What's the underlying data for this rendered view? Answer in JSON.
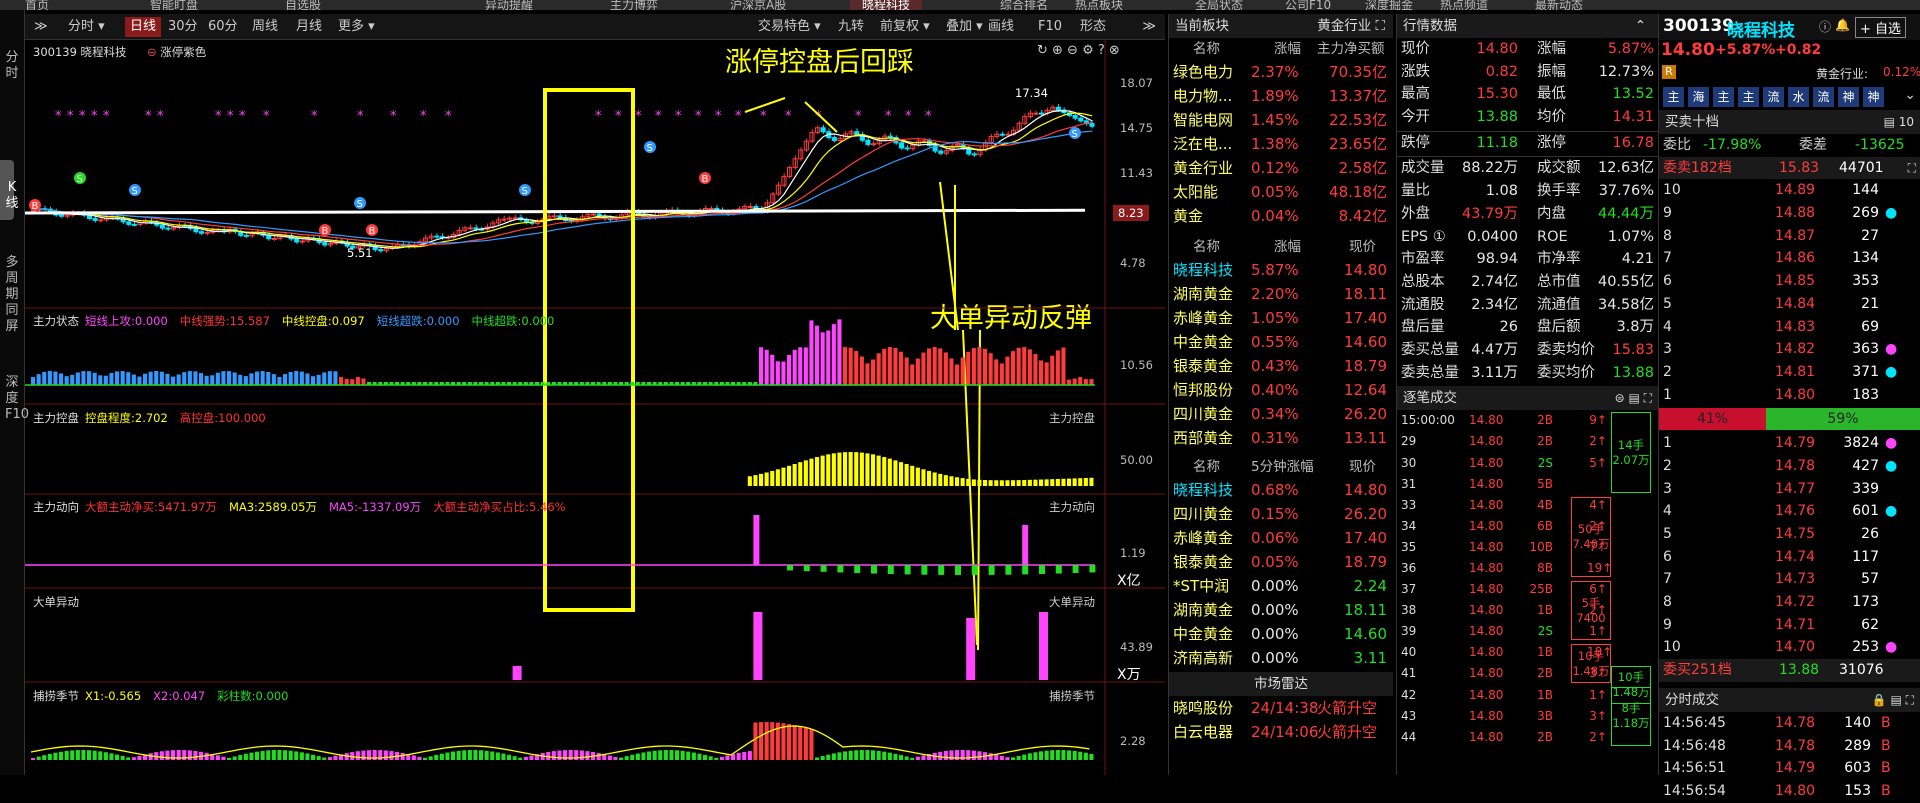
{
  "topbar": {
    "tabs": [
      "首页",
      "智能盯盘",
      "自选股",
      "异动提醒",
      "主力博弈",
      "沪深京A股",
      "晓程科技",
      "综合排名",
      "热点板块",
      "全局状态",
      "公司F10",
      "深度掘金",
      "热点频道",
      "最新动态"
    ],
    "active": 6
  },
  "leftbar": {
    "items": [
      "分时",
      "K线",
      "多周期同屏",
      "深度F10"
    ]
  },
  "toolbar": {
    "left": [
      "分时",
      "日线",
      "30分",
      "60分",
      "周线",
      "月线",
      "更多"
    ],
    "active": "日线",
    "right": [
      "交易特色",
      "九转",
      "前复权",
      "叠加",
      "画线",
      "F10",
      "形态"
    ]
  },
  "chart": {
    "stock_title": "300139 晓程科技",
    "indicator": "涨停紫色",
    "annotation1": "涨停控盘后回踩",
    "annotation2": "大单异动反弹",
    "axis_main": [
      "18.07",
      "14.75",
      "11.43",
      "8.23",
      "4.78"
    ],
    "low_label": "5.51",
    "high_label": "17.34",
    "p1": {
      "title": "主力状态",
      "items": [
        {
          "t": "短线上攻:0.000",
          "c": "#ff44ff"
        },
        {
          "t": "中线强势:15.587",
          "c": "#ff3333"
        },
        {
          "t": "中线控盘:0.097",
          "c": "#ffff00"
        },
        {
          "t": "短线超跌:0.000",
          "c": "#3399ff"
        },
        {
          "t": "中线超跌:0.000",
          "c": "#22dd22"
        }
      ],
      "axis": "10.56"
    },
    "p2": {
      "title": "主力控盘",
      "items": [
        {
          "t": "控盘程度:2.702",
          "c": "#ffff00"
        },
        {
          "t": "高控盘:100.000",
          "c": "#ff3333"
        }
      ],
      "right": "主力控盘",
      "axis": "50.00"
    },
    "p3": {
      "title": "主力动向",
      "items": [
        {
          "t": "大额主动净买:5471.97万",
          "c": "#ff3333"
        },
        {
          "t": "MA3:2589.05万",
          "c": "#ffff00"
        },
        {
          "t": "MA5:-1337.09万",
          "c": "#ff44ff"
        },
        {
          "t": "大额主动净买占比:5.46%",
          "c": "#ff3333"
        }
      ],
      "right": "主力动向",
      "axis": "1.19",
      "unit": "X亿"
    },
    "p4": {
      "title": "大单异动",
      "right": "大单异动",
      "axis": "43.89",
      "unit": "X万"
    },
    "p5": {
      "title": "捕捞季节",
      "items": [
        {
          "t": "X1:-0.565",
          "c": "#ffff00"
        },
        {
          "t": "X2:0.047",
          "c": "#ff44ff"
        },
        {
          "t": "彩柱数:0.000",
          "c": "#22dd22"
        }
      ],
      "right": "捕捞季节",
      "axis": "2.28"
    }
  },
  "sector": {
    "title": "当前板块",
    "right": "黄金行业",
    "cols": [
      "名称",
      "涨幅",
      "主力净买额"
    ],
    "rows": [
      [
        "绿色电力",
        "2.37%",
        "70.35亿"
      ],
      [
        "电力物...",
        "1.89%",
        "13.37亿"
      ],
      [
        "智能电网",
        "1.45%",
        "22.53亿"
      ],
      [
        "泛在电...",
        "1.38%",
        "23.65亿"
      ],
      [
        "黄金行业",
        "0.12%",
        "2.58亿"
      ],
      [
        "太阳能",
        "0.05%",
        "48.18亿"
      ],
      [
        "黄金",
        "0.04%",
        "8.42亿"
      ]
    ],
    "cols2": [
      "名称",
      "涨幅",
      "现价"
    ],
    "rows2": [
      [
        "晓程科技",
        "5.87%",
        "14.80"
      ],
      [
        "湖南黄金",
        "2.20%",
        "18.11"
      ],
      [
        "赤峰黄金",
        "1.05%",
        "17.40"
      ],
      [
        "中金黄金",
        "0.55%",
        "14.60"
      ],
      [
        "银泰黄金",
        "0.43%",
        "18.79"
      ],
      [
        "恒邦股份",
        "0.40%",
        "12.64"
      ],
      [
        "四川黄金",
        "0.34%",
        "26.20"
      ],
      [
        "西部黄金",
        "0.31%",
        "13.11"
      ]
    ],
    "cols3": [
      "名称",
      "5分钟涨幅",
      "现价"
    ],
    "rows3": [
      [
        "晓程科技",
        "0.68%",
        "14.80"
      ],
      [
        "四川黄金",
        "0.15%",
        "26.20"
      ],
      [
        "赤峰黄金",
        "0.06%",
        "17.40"
      ],
      [
        "银泰黄金",
        "0.05%",
        "18.79"
      ],
      [
        "*ST中润",
        "0.00%",
        "2.24"
      ],
      [
        "湖南黄金",
        "0.00%",
        "18.11"
      ],
      [
        "中金黄金",
        "0.00%",
        "14.60"
      ],
      [
        "济南高新",
        "0.00%",
        "3.11"
      ]
    ],
    "radar_title": "市场雷达",
    "radar": [
      [
        "晓鸣股份",
        "24/14:38",
        "火箭升空"
      ],
      [
        "白云电器",
        "24/14:06",
        "火箭升空"
      ]
    ]
  },
  "market": {
    "title": "行情数据",
    "rows": [
      [
        "现价",
        "14.80",
        "涨幅",
        "5.87%"
      ],
      [
        "涨跌",
        "0.82",
        "振幅",
        "12.73%"
      ],
      [
        "最高",
        "15.30",
        "最低",
        "13.52"
      ],
      [
        "今开",
        "13.88",
        "均价",
        "14.31"
      ]
    ],
    "rows_b": [
      [
        "跌停",
        "11.18",
        "涨停",
        "16.78"
      ]
    ],
    "rows_c": [
      [
        "成交量",
        "88.22万",
        "成交额",
        "12.63亿"
      ],
      [
        "量比",
        "1.08",
        "换手率",
        "37.76%"
      ],
      [
        "外盘",
        "43.79万",
        "内盘",
        "44.44万"
      ],
      [
        "EPS ①",
        "0.0400",
        "ROE",
        "1.07%"
      ],
      [
        "市盈率",
        "98.94",
        "市净率",
        "4.21"
      ],
      [
        "总股本",
        "2.74亿",
        "总市值",
        "40.55亿"
      ],
      [
        "流通股",
        "2.34亿",
        "流通值",
        "34.58亿"
      ],
      [
        "盘后量",
        "26",
        "盘后额",
        "3.8万"
      ],
      [
        "委买总量",
        "4.47万",
        "委卖均价",
        "15.83"
      ],
      [
        "委卖总量",
        "3.11万",
        "委买均价",
        "13.88"
      ]
    ],
    "ticks_title": "逐笔成交",
    "ticks": [
      [
        "15:00:00",
        "14.80",
        "2B",
        "9"
      ],
      [
        "29",
        "14.80",
        "2B",
        "2"
      ],
      [
        "30",
        "14.80",
        "2S",
        "5"
      ],
      [
        "31",
        "14.80",
        "5B",
        ""
      ],
      [
        "33",
        "14.80",
        "4B",
        "4"
      ],
      [
        "34",
        "14.80",
        "6B",
        "2"
      ],
      [
        "35",
        "14.80",
        "10B",
        "7"
      ],
      [
        "36",
        "14.80",
        "8B",
        "19"
      ],
      [
        "37",
        "14.80",
        "25B",
        "6"
      ],
      [
        "38",
        "14.80",
        "1B",
        "2"
      ],
      [
        "39",
        "14.80",
        "2S",
        "1"
      ],
      [
        "40",
        "14.80",
        "1B",
        "18"
      ],
      [
        "41",
        "14.80",
        "2B",
        "3"
      ],
      [
        "42",
        "14.80",
        "1B",
        "1"
      ],
      [
        "43",
        "14.80",
        "3B",
        "3"
      ],
      [
        "44",
        "14.80",
        "2B",
        "2"
      ]
    ],
    "tick_boxes": [
      {
        "l1": "14手",
        "l2": "2.07万"
      },
      {
        "l1": "50手",
        "l2": "7.40万"
      },
      {
        "l1": "5手",
        "l2": "7400"
      },
      {
        "l1": "10手",
        "l2": "1.48万"
      },
      {
        "l1": "10手",
        "l2": "1.48万"
      },
      {
        "l1": "8手",
        "l2": "1.18万"
      }
    ]
  },
  "right": {
    "code": "300139",
    "name": "晓程科技",
    "self_select": "自选",
    "price": "14.80",
    "chg": "+5.87%",
    "chg_abs": "+0.82",
    "badge": "R",
    "industry": "黄金行业:",
    "industry_chg": "0.12%",
    "tags": [
      "主",
      "海",
      "主",
      "主",
      "流",
      "水",
      "流",
      "神",
      "神"
    ],
    "book_title": "买卖十档",
    "weibi": [
      "委比",
      "-17.98%",
      "委差",
      "-13625"
    ],
    "sell_sum": [
      "委卖182档",
      "15.83",
      "44701"
    ],
    "sells": [
      [
        "10",
        "14.89",
        "144"
      ],
      [
        "9",
        "14.88",
        "269"
      ],
      [
        "8",
        "14.87",
        "27"
      ],
      [
        "7",
        "14.86",
        "134"
      ],
      [
        "6",
        "14.85",
        "353"
      ],
      [
        "5",
        "14.84",
        "21"
      ],
      [
        "4",
        "14.83",
        "69"
      ],
      [
        "3",
        "14.82",
        "363"
      ],
      [
        "2",
        "14.81",
        "371"
      ],
      [
        "1",
        "14.80",
        "183"
      ]
    ],
    "ratio": [
      "41%",
      "59%"
    ],
    "buys": [
      [
        "1",
        "14.79",
        "3824"
      ],
      [
        "2",
        "14.78",
        "427"
      ],
      [
        "3",
        "14.77",
        "339"
      ],
      [
        "4",
        "14.76",
        "601"
      ],
      [
        "5",
        "14.75",
        "26"
      ],
      [
        "6",
        "14.74",
        "117"
      ],
      [
        "7",
        "14.73",
        "57"
      ],
      [
        "8",
        "14.72",
        "173"
      ],
      [
        "9",
        "14.71",
        "62"
      ],
      [
        "10",
        "14.70",
        "253"
      ]
    ],
    "buy_sum": [
      "委买251档",
      "13.88",
      "31076"
    ],
    "trades_title": "分时成交",
    "trades": [
      [
        "14:56:45",
        "14.78",
        "140",
        "B"
      ],
      [
        "14:56:48",
        "14.78",
        "289",
        "B"
      ],
      [
        "14:56:51",
        "14.79",
        "603",
        "B"
      ],
      [
        "14:56:54",
        "14.80",
        "153",
        "B"
      ]
    ]
  },
  "colors": {
    "up": "#ff3b3b",
    "down": "#22dd22",
    "accent": "#ffff00",
    "panel_sep": "#6b1515"
  }
}
